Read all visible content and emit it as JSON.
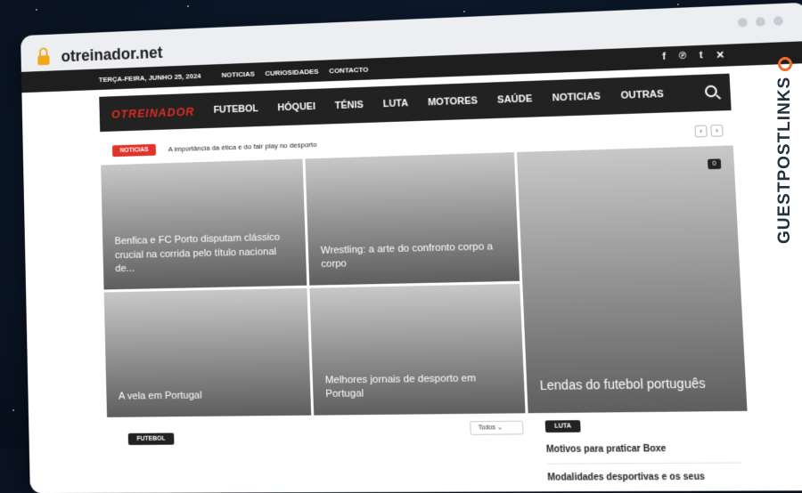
{
  "browser": {
    "url": "otreinador.net"
  },
  "topbar": {
    "date": "TERÇA-FEIRA, JUNHO 25, 2024",
    "links": [
      "NOTICIAS",
      "CURIOSIDADES",
      "CONTACTO"
    ],
    "social": [
      "facebook-icon",
      "pinterest-icon",
      "tumblr-icon",
      "x-icon"
    ]
  },
  "nav": {
    "logo": "OTREINADOR",
    "menu": [
      "FUTEBOL",
      "HÓQUEI",
      "TÉNIS",
      "LUTA",
      "MOTORES",
      "SAÚDE",
      "NOTICIAS",
      "OUTRAS"
    ]
  },
  "ticker": {
    "badge": "NOTICIAS",
    "headline": "A importância da ética e do fair play no desporto"
  },
  "featured": [
    {
      "title": "Benfica e FC Porto disputam clássico crucial na corrida pelo título nacional de..."
    },
    {
      "title": "Wrestling: a arte do confronto corpo a corpo"
    },
    {
      "title": "Lendas do futebol português",
      "comments": "0"
    },
    {
      "title": "A vela em Portugal"
    },
    {
      "title": "Melhores jornais de desporto em Portugal"
    }
  ],
  "sections": {
    "left_badge": "FUTEBOL",
    "filter": "Todos",
    "right_badge": "LUTA",
    "right_items": [
      "Motivos para praticar Boxe",
      "Modalidades desportivas e os seus"
    ]
  },
  "watermark": {
    "text": "GUESTPOSTLINKS"
  },
  "colors": {
    "accent": "#e0332a",
    "dark": "#222222",
    "watermark": "#f26a2e"
  }
}
